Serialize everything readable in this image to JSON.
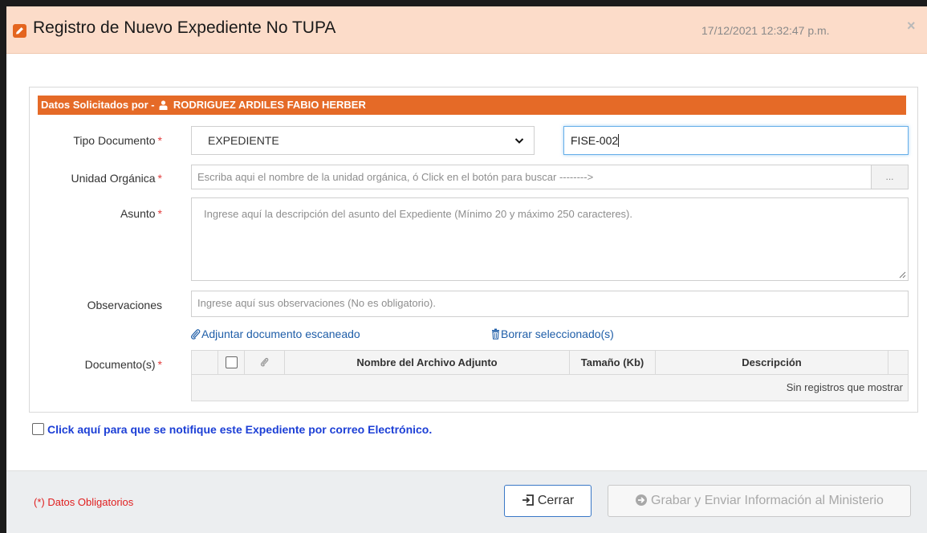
{
  "header": {
    "title": "Registro de Nuevo Expediente No TUPA",
    "timestamp": "17/12/2021 12:32:47 p.m.",
    "close_glyph": "×"
  },
  "section": {
    "heading_prefix": "Datos Solicitados por -",
    "requester": "RODRIGUEZ ARDILES FABIO HERBER"
  },
  "form": {
    "required_mark": "*",
    "tipo_documento": {
      "label": "Tipo Documento",
      "selected": "EXPEDIENTE",
      "number_value": "FISE-002"
    },
    "unidad_organica": {
      "label": "Unidad Orgánica",
      "placeholder": "Escriba aqui el nombre de la unidad orgánica, ó Click en el botón para buscar -------->",
      "search_button": "..."
    },
    "asunto": {
      "label": "Asunto",
      "placeholder": "Ingrese aquí la descripción del asunto del Expediente (Mínimo 20 y máximo 250 caracteres)."
    },
    "observaciones": {
      "label": "Observaciones",
      "placeholder": "Ingrese aquí sus observaciones (No es obligatorio)."
    },
    "attach_link": "Adjuntar documento escaneado",
    "delete_link": "Borrar seleccionado(s)",
    "documentos": {
      "label": "Documento(s)",
      "columns": [
        "Nombre del Archivo Adjunto",
        "Tamaño (Kb)",
        "Descripción"
      ],
      "empty_message": "Sin registros que mostrar"
    }
  },
  "notify": {
    "label": "Click aquí para que se notifique este Expediente por correo Electrónico."
  },
  "footer": {
    "required_note": "(*) Datos Obligatorios",
    "close_button": "Cerrar",
    "submit_button": "Grabar y Enviar Información al Ministerio"
  },
  "colors": {
    "header_bg": "#fcdcc9",
    "accent_orange": "#e56a27",
    "link_blue": "#1f5ea8",
    "notify_blue": "#1c3fd6",
    "required_red": "#e02020"
  },
  "icons": {
    "title": "edit-icon",
    "requester": "user-icon",
    "attach": "paperclip-icon",
    "delete": "trash-icon",
    "close_button": "sign-out-icon",
    "submit_button": "circle-arrow-right-icon"
  }
}
